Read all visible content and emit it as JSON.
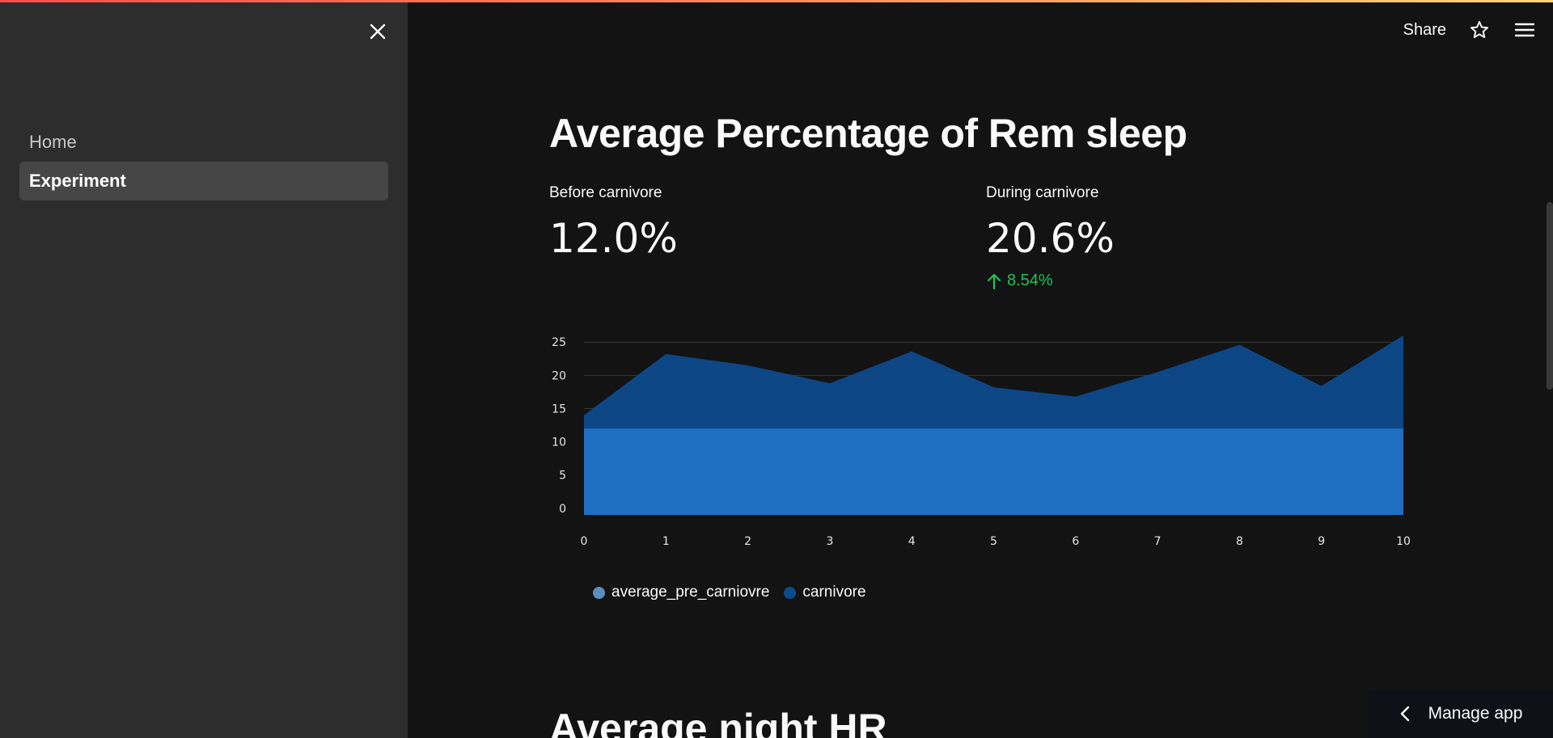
{
  "sidebar": {
    "items": [
      {
        "label": "Home",
        "active": false
      },
      {
        "label": "Experiment",
        "active": true
      }
    ]
  },
  "header": {
    "share_label": "Share"
  },
  "main": {
    "title": "Average Percentage of Rem sleep",
    "metrics": [
      {
        "label": "Before carnivore",
        "value": "12.0%"
      },
      {
        "label": "During carnivore",
        "value": "20.6%",
        "delta": "8.54%",
        "delta_direction": "up"
      }
    ],
    "second_title": "Average night HR"
  },
  "manage_app_label": "Manage app",
  "colors": {
    "accent_delta": "#21c354",
    "series_pre": "#2f7fd3",
    "series_carnivore": "#0d4b8f"
  },
  "chart_data": {
    "type": "area",
    "x": [
      0,
      1,
      2,
      3,
      4,
      5,
      6,
      7,
      8,
      9,
      10
    ],
    "series": [
      {
        "name": "average_pre_carniovre",
        "values": [
          12.0,
          12.0,
          12.0,
          12.0,
          12.0,
          12.0,
          12.0,
          12.0,
          12.0,
          12.0,
          12.0
        ],
        "color": "#5b8fbd"
      },
      {
        "name": "carnivore",
        "values": [
          14.0,
          23.2,
          21.5,
          18.8,
          23.6,
          18.2,
          16.8,
          20.5,
          24.6,
          18.4,
          26.0
        ],
        "color": "#0d4b8f"
      }
    ],
    "xlim": [
      0,
      10
    ],
    "ylim": [
      -1,
      26
    ],
    "y_ticks": [
      0,
      5,
      10,
      15,
      20,
      25
    ],
    "grid": true,
    "legend": "bottom-left"
  }
}
